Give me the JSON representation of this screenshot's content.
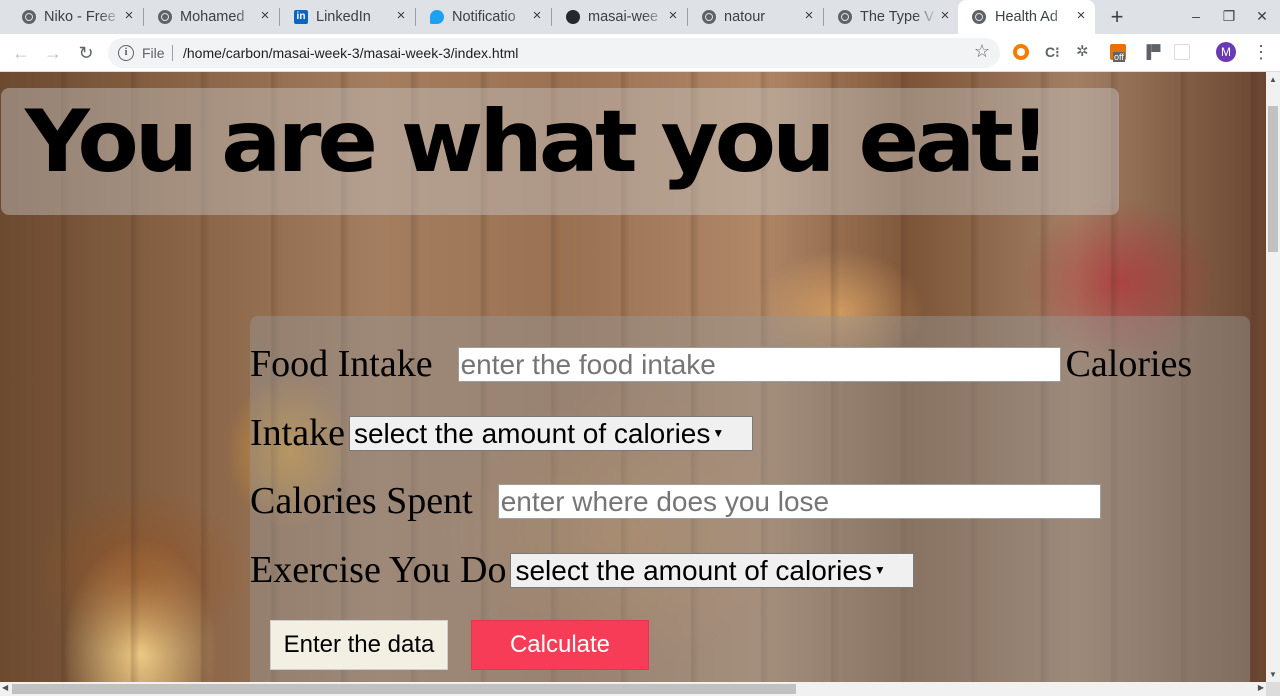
{
  "browser": {
    "tabs": [
      {
        "title": "Niko - Free",
        "icon": "globe-icon"
      },
      {
        "title": "Mohamed",
        "icon": "globe-icon"
      },
      {
        "title": "LinkedIn",
        "icon": "linkedin-icon"
      },
      {
        "title": "Notificatio",
        "icon": "twitter-icon"
      },
      {
        "title": "masai-wee",
        "icon": "github-icon"
      },
      {
        "title": "natour",
        "icon": "globe-icon"
      },
      {
        "title": "The Type V",
        "icon": "globe-icon"
      },
      {
        "title": "Health Ad",
        "icon": "globe-icon",
        "active": true
      }
    ],
    "close_glyph": "×",
    "new_tab_glyph": "+",
    "window_controls": {
      "minimize": "–",
      "restore": "❐",
      "close": "✕"
    },
    "address": {
      "scheme_label": "File",
      "url": "/home/carbon/masai-week-3/masai-week-3/index.html"
    },
    "profile_initial": "M",
    "extension_badge": "off"
  },
  "page": {
    "headline": "You are what you eat!",
    "form": {
      "food_intake_label": "Food Intake",
      "food_intake_placeholder": "enter the food intake",
      "calories_label": "Calories",
      "intake_label": "Intake",
      "intake_select": "select the amount of calories",
      "calories_spent_label": "Calories Spent",
      "calories_spent_placeholder": "enter where does you lose",
      "exercise_label": "Exercise You Do",
      "exercise_select": "select the amount of calories",
      "enter_button": "Enter the data",
      "calculate_button": "Calculate"
    }
  },
  "colors": {
    "calculate_bg": "#f73c57",
    "enter_bg": "#f3efe3",
    "tabstrip_bg": "#dee1e6",
    "avatar_bg": "#6a3ab2"
  }
}
